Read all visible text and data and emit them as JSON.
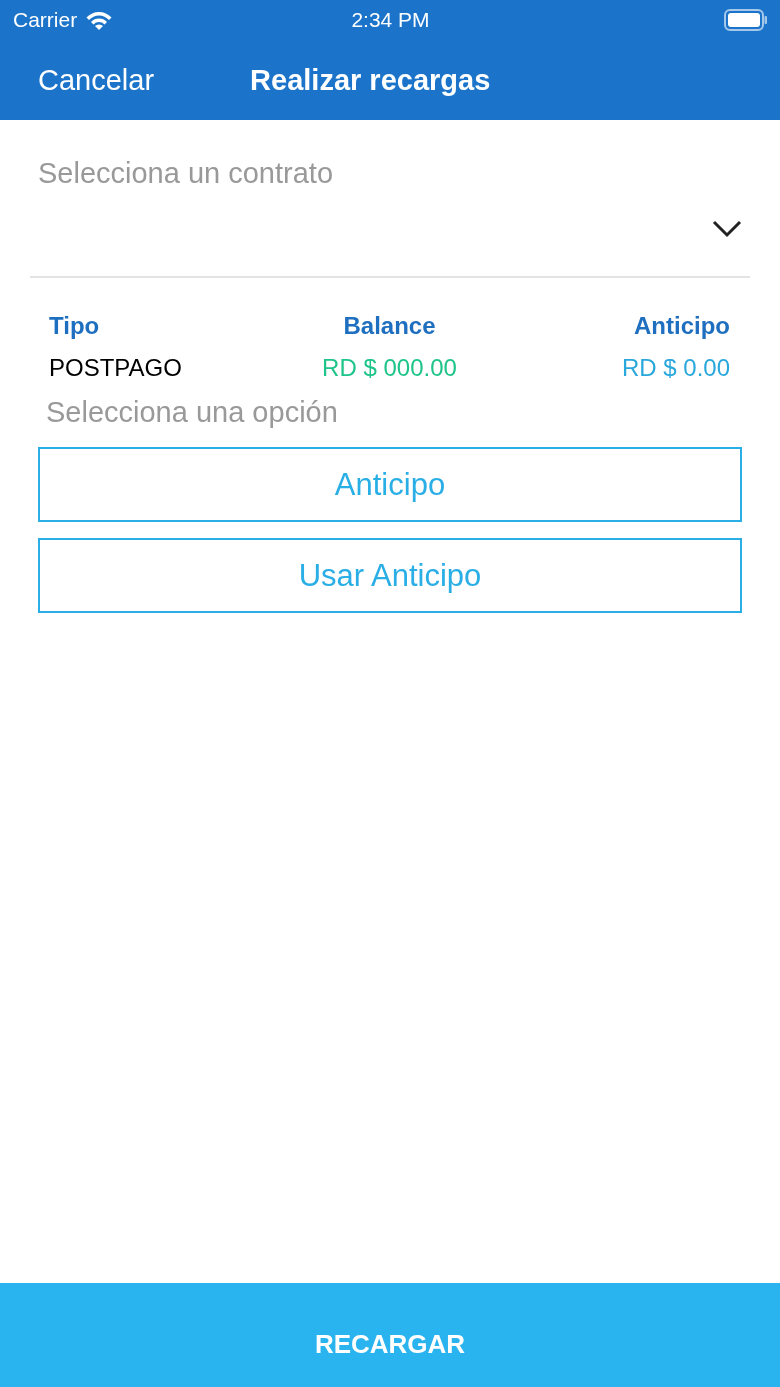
{
  "status_bar": {
    "carrier": "Carrier",
    "time": "2:34 PM"
  },
  "nav": {
    "back": "Cancelar",
    "title": "Realizar recargas"
  },
  "contract": {
    "label": "Selecciona un contrato"
  },
  "table": {
    "columns": [
      "Tipo",
      "Balance",
      "Anticipo"
    ],
    "row": [
      "POSTPAGO",
      "RD $ 000.00",
      "RD $ 0.00"
    ]
  },
  "options_label": "Selecciona una opción",
  "options": [
    "Anticipo",
    "Usar Anticipo"
  ],
  "submit": "RECARGAR"
}
